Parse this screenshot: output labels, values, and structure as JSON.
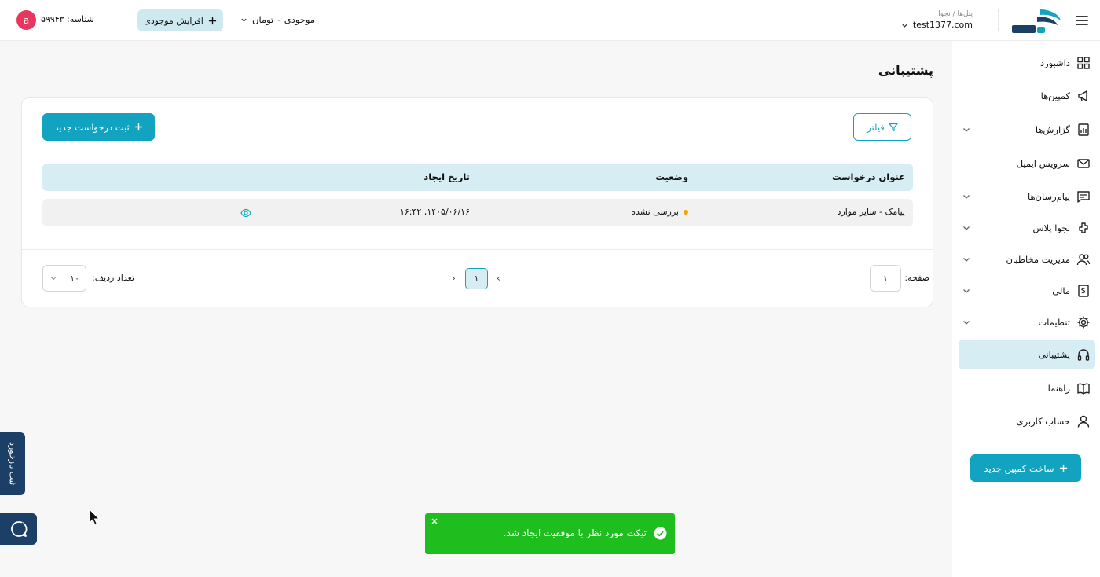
{
  "header": {
    "breadcrumb": "پنل‌ها / نجوا",
    "panel_name": "test1377.com",
    "balance_label": "موجودی ۰ تومان",
    "topup_label": "افزایش موجودی",
    "account_id": "شناسه: ۵۹۹۴۳",
    "avatar_letter": "a"
  },
  "sidebar": {
    "items": [
      {
        "label": "داشبورد"
      },
      {
        "label": "کمپین‌ها"
      },
      {
        "label": "گزارش‌ها"
      },
      {
        "label": "سرویس ایمیل"
      },
      {
        "label": "پیام‌رسان‌ها"
      },
      {
        "label": "نجوا پلاس"
      },
      {
        "label": "مدیریت مخاطبان"
      },
      {
        "label": "مالی"
      },
      {
        "label": "تنظیمات"
      },
      {
        "label": "پشتیبانی"
      },
      {
        "label": "راهنما"
      },
      {
        "label": "حساب کاربری"
      }
    ],
    "new_campaign_label": "ساخت کمپین جدید"
  },
  "page": {
    "title": "پشتیبانی",
    "filter_label": "فیلتر",
    "new_request_label": "ثبت درخواست جدید"
  },
  "table": {
    "columns": [
      "عنوان درخواست",
      "وضعیت",
      "تاریخ ایجاد"
    ],
    "rows": [
      {
        "title": "پیامک - سایر موارد",
        "status": "بررسی نشده",
        "created": "۱۴۰۵/۰۶/۱۶, ۱۶:۴۲"
      }
    ]
  },
  "pagination": {
    "page_label": "صفحه:",
    "page_input": "۱",
    "current_page": "۱",
    "rows_label": "تعداد ردیف:",
    "rows_value": "۱۰"
  },
  "side_tabs": {
    "feedback_label": "ثبت بازخورد"
  },
  "toast": {
    "message": "تیکت مورد نظر با موفقیت ایجاد شد."
  },
  "colors": {
    "primary": "#11a3bf",
    "active_bg": "#d6edf3",
    "status_pending": "#f0a500",
    "toast_success": "#1fbe1f",
    "side_tab_bg": "#1b3f66",
    "avatar_bg": "#e8375f"
  }
}
